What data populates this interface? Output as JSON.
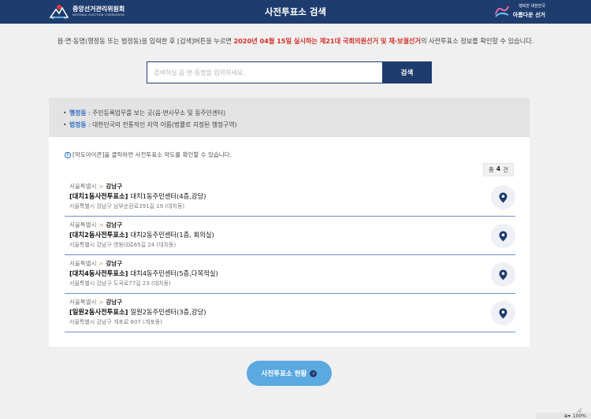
{
  "header": {
    "logo_text": "중앙선거관리위원회",
    "logo_subtext": "NATIONAL ELECTION COMMISSION",
    "title": "사전투표소 검색",
    "right_logo_text": "아름다운 선거",
    "right_logo_subtext": "행복한 대한민국"
  },
  "description": {
    "part1": "읍·면·동명(행정동 또는 법정동)을 입력한 후 [검색]버튼을 누르면 ",
    "highlight1": "2020년 04월 15일 실시하는 제21대 국회의원선거 및 재·보궐선거",
    "part2": "의 사전투표소 정보를 확인할 수 있습니다."
  },
  "search": {
    "placeholder": "검색하실 읍·면·동명을 입력하세요.",
    "value": "",
    "button_label": "검색"
  },
  "info": {
    "bullet": "•",
    "lines": [
      {
        "term": "행정동",
        "text": " : 주민등록업무를 보는 곳(읍·면사무소 및 동주민센터)"
      },
      {
        "term": "법정동",
        "text": " : 대한민국의 전통적인 지역 이름(법률로 지정된 행정구역)"
      }
    ]
  },
  "results": {
    "hint_icon_glyph": "i",
    "hint": "[약도아이콘]을 클릭하면 사전투표소 약도를 확인할 수 있습니다.",
    "count_prefix": "총",
    "count": "4",
    "count_suffix": "건",
    "separator": ">",
    "items": [
      {
        "city": "서울특별시",
        "gu": "강남구",
        "station": "[대치1동사전투표소]",
        "place": "대치1동주민센터(4층,강당)",
        "address": "서울특별시 강남구 남부순환로391길 19 (대치동)"
      },
      {
        "city": "서울특별시",
        "gu": "강남구",
        "station": "[대치2동사전투표소]",
        "place": "대치2동주민센터(1층, 회의실)",
        "address": "서울특별시 강남구 영동대로65길 24 (대치동)"
      },
      {
        "city": "서울특별시",
        "gu": "강남구",
        "station": "[대치4동사전투표소]",
        "place": "대치4동주민센터(5층,다목적실)",
        "address": "서울특별시 강남구 도곡로77길 23 (대치동)"
      },
      {
        "city": "서울특별시",
        "gu": "강남구",
        "station": "[일원2동사전투표소]",
        "place": "일원2동주민센터(3층,강당)",
        "address": "서울특별시 강남구 개포로 607 (개포동)"
      }
    ]
  },
  "status_button": {
    "label": "사전투표소 현황",
    "arrow_glyph": "›"
  },
  "zoom": {
    "value": "100%"
  },
  "colors": {
    "navy": "#1f3c6e",
    "accent_red": "#d2302a",
    "link_blue": "#2b6bc2",
    "button_sky": "#5aa9e0"
  }
}
